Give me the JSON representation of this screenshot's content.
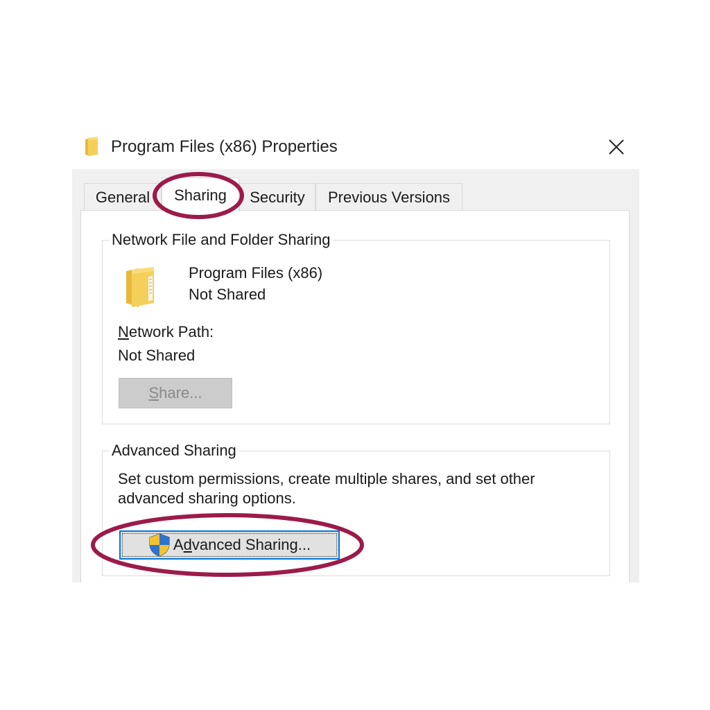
{
  "window": {
    "title": "Program Files (x86) Properties",
    "icon": "folder-icon",
    "close_icon": "close-icon"
  },
  "tabs": [
    {
      "label": "General",
      "active": false
    },
    {
      "label": "Sharing",
      "active": true
    },
    {
      "label": "Security",
      "active": false
    },
    {
      "label": "Previous Versions",
      "active": false
    }
  ],
  "network_sharing": {
    "group_title": "Network File and Folder Sharing",
    "folder_name": "Program Files (x86)",
    "share_status": "Not Shared",
    "network_path_label_mnemonic": "N",
    "network_path_label_rest": "etwork Path:",
    "network_path_value": "Not Shared",
    "share_button_mnemonic": "S",
    "share_button_rest": "hare...",
    "share_button_enabled": false
  },
  "advanced_sharing": {
    "group_title": "Advanced Sharing",
    "description_line1": "Set custom permissions, create multiple shares, and set other",
    "description_line2": "advanced sharing options.",
    "button_prefix": "A",
    "button_mnemonic": "d",
    "button_rest": "vanced Sharing...",
    "button_icon": "uac-shield-icon"
  },
  "annotations": {
    "color": "#9b1b4a",
    "circled_items": [
      "tab-sharing",
      "advanced-sharing-button"
    ]
  },
  "colors": {
    "window_bg": "#f0f0f0",
    "page_bg": "#ffffff",
    "focus_border": "#0078d7",
    "folder_yellow": "#f5cf5c"
  }
}
